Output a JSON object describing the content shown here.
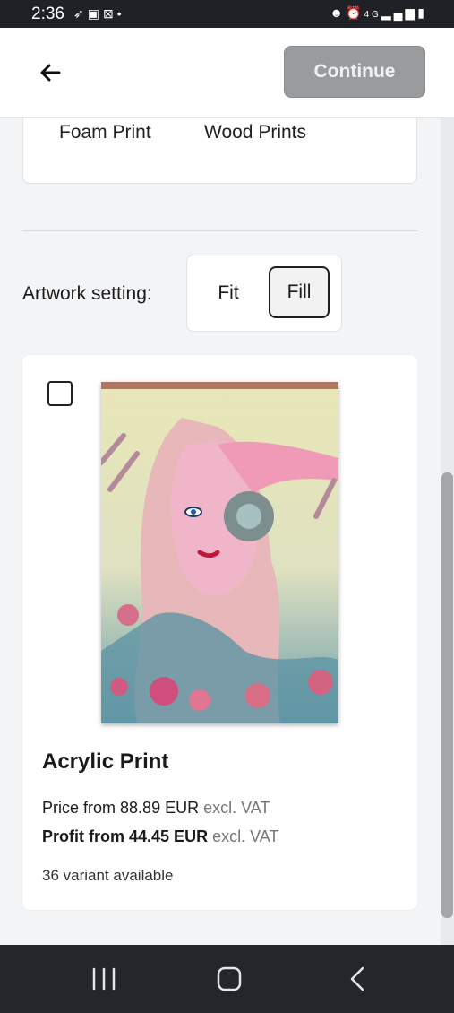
{
  "status_bar": {
    "time": "2:36",
    "left_icons": [
      "rocket-icon",
      "image-icon",
      "outlook-icon",
      "dot-icon"
    ],
    "right_icons": [
      "face-icon",
      "alarm-icon",
      "4g-icon",
      "signal-icon",
      "battery-icon"
    ],
    "network": "4G"
  },
  "header": {
    "back_icon": "arrow-left-icon",
    "continue_label": "Continue"
  },
  "materials": {
    "items": [
      "Foam Print",
      "Wood Prints"
    ]
  },
  "artwork_setting": {
    "label": "Artwork setting:",
    "options": [
      "Fit",
      "Fill"
    ],
    "selected": "Fill"
  },
  "product": {
    "checked": false,
    "title": "Acrylic Print",
    "price_prefix": "Price from",
    "price_value": "88.89 EUR",
    "price_suffix": "excl. VAT",
    "profit_prefix": "Profit from",
    "profit_value": "44.45 EUR",
    "profit_suffix": "excl. VAT",
    "variants": "36 variant available"
  },
  "nav_bar": {
    "buttons": [
      "recent-apps-icon",
      "home-icon",
      "back-icon"
    ]
  },
  "colors": {
    "continue_disabled": "#9a9b9d",
    "background": "#f3f4f6",
    "nav_bar": "#24262b"
  }
}
